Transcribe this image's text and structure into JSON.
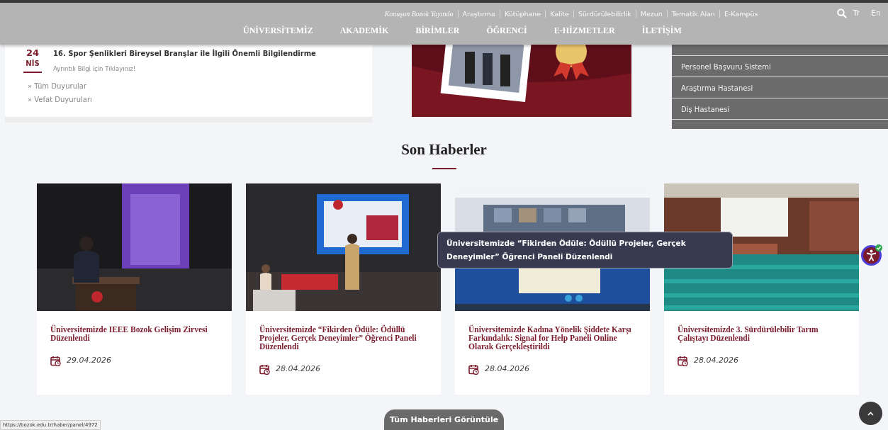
{
  "header": {
    "top_links": [
      {
        "text": "Konuşan Bozok Yayında",
        "kind": "featured"
      },
      {
        "text": "Araştırma",
        "kind": "link"
      },
      {
        "text": "Kütüphane",
        "kind": "link"
      },
      {
        "text": "Kalite",
        "kind": "link"
      },
      {
        "text": "Sürdürülebilirlik",
        "kind": "link"
      },
      {
        "text": "Mezun",
        "kind": "link"
      },
      {
        "text": "Tematik Alan",
        "kind": "link"
      },
      {
        "text": "E-Kampüs",
        "kind": "link"
      }
    ],
    "languages": [
      "Tr",
      "En"
    ],
    "nav": [
      "ÜNİVERSİTEMİZ",
      "AKADEMİK",
      "BİRİMLER",
      "ÖĞRENCİ",
      "E-HİZMETLER",
      "İLETİŞİM"
    ]
  },
  "announcement": {
    "day": "24",
    "month": "NİS",
    "title": "16. Spor Şenlikleri Bireysel Branşlar ile İlgili Önemli Bilgilendirme",
    "subtitle": "Ayrıntılı Bilgi için Tıklayınız!",
    "links": [
      "» Tüm Duyurular",
      "» Vefat Duyuruları"
    ]
  },
  "quick_links": [
    "Personel Başvuru Sistemi",
    "Araştırma Hastanesi",
    "Diş Hastanesi"
  ],
  "news": {
    "title": "Son Haberler",
    "items": [
      {
        "title": "Üniversitemizde IEEE Bozok Gelişim Zirvesi Düzenlendi",
        "date": "29.04.2026"
      },
      {
        "title": "Üniversitemizde “Fikirden Ödüle: Ödüllü Projeler, Gerçek Deneyimler” Öğrenci Paneli Düzenlendi",
        "date": "28.04.2026"
      },
      {
        "title": "Üniversitemizde Kadına Yönelik Şiddete Karşı Farkındalık: Signal for Help Paneli Online Olarak Gerçekleştirildi",
        "date": "28.04.2026"
      },
      {
        "title": "Üniversitemizde 3. Sürdürülebilir Tarım Çalıştayı Düzenlendi",
        "date": "28.04.2026"
      }
    ],
    "button": "Tüm Haberleri Görüntüle"
  },
  "tooltip": "Üniversitemizde “Fikirden Ödüle: Ödüllü Projeler, Gerçek Deneyimler” Öğrenci Paneli Düzenlendi",
  "status_url": "https://bozok.edu.tr/haber/panel/4972"
}
